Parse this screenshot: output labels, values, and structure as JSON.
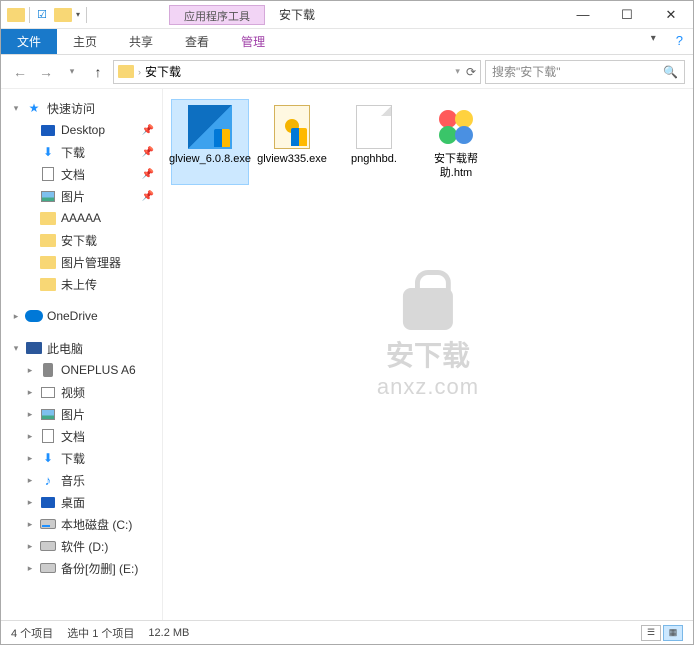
{
  "title": {
    "context_tab": "应用程序工具",
    "folder_name": "安下载"
  },
  "ribbon": {
    "file": "文件",
    "home": "主页",
    "share": "共享",
    "view": "查看",
    "manage": "管理"
  },
  "address": {
    "crumb": "安下载",
    "search_placeholder": "搜索\"安下载\""
  },
  "sidebar": {
    "quick_access": "快速访问",
    "items_qa": [
      {
        "label": "Desktop",
        "icon": "desktop",
        "pinned": true
      },
      {
        "label": "下载",
        "icon": "download",
        "pinned": true
      },
      {
        "label": "文档",
        "icon": "doc",
        "pinned": true
      },
      {
        "label": "图片",
        "icon": "pic",
        "pinned": true
      },
      {
        "label": "AAAAA",
        "icon": "folder"
      },
      {
        "label": "安下载",
        "icon": "folder"
      },
      {
        "label": "图片管理器",
        "icon": "folder"
      },
      {
        "label": "未上传",
        "icon": "folder"
      }
    ],
    "onedrive": "OneDrive",
    "this_pc": "此电脑",
    "items_pc": [
      {
        "label": "ONEPLUS A6",
        "icon": "phone"
      },
      {
        "label": "视频",
        "icon": "video"
      },
      {
        "label": "图片",
        "icon": "pic"
      },
      {
        "label": "文档",
        "icon": "doc"
      },
      {
        "label": "下载",
        "icon": "download"
      },
      {
        "label": "音乐",
        "icon": "music"
      },
      {
        "label": "桌面",
        "icon": "desktop"
      },
      {
        "label": "本地磁盘 (C:)",
        "icon": "drive-c"
      },
      {
        "label": "软件 (D:)",
        "icon": "drive"
      },
      {
        "label": "备份[勿删] (E:)",
        "icon": "drive"
      }
    ]
  },
  "files": [
    {
      "name": "glview_6.0.8.exe",
      "type": "exe1",
      "selected": true
    },
    {
      "name": "glview335.exe",
      "type": "exe2"
    },
    {
      "name": "pnghhbd.",
      "type": "blank"
    },
    {
      "name": "安下载帮助.htm",
      "type": "htm"
    }
  ],
  "watermark": {
    "line1": "安下载",
    "line2": "anxz.com"
  },
  "status": {
    "count": "4 个项目",
    "selected": "选中 1 个项目",
    "size": "12.2 MB"
  }
}
